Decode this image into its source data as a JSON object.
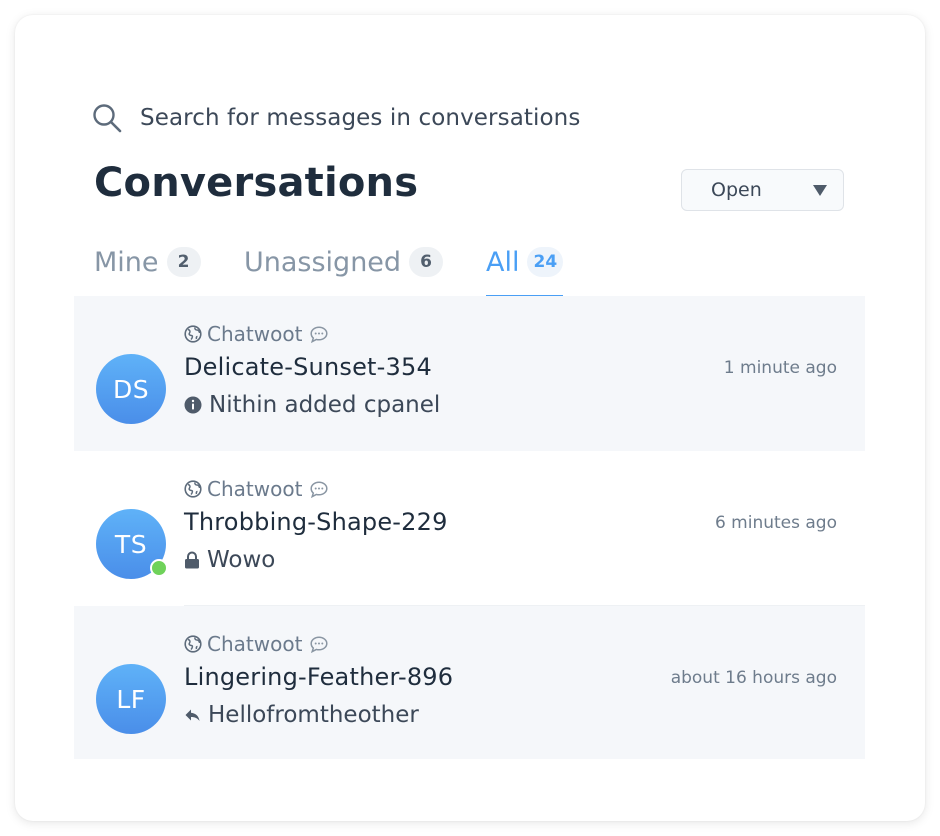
{
  "search": {
    "placeholder": "Search for messages in conversations"
  },
  "header": {
    "title": "Conversations",
    "status_filter": "Open"
  },
  "tabs": [
    {
      "label": "Mine",
      "count": "2"
    },
    {
      "label": "Unassigned",
      "count": "6"
    },
    {
      "label": "All",
      "count": "24",
      "active": true
    }
  ],
  "conversations": [
    {
      "initials": "DS",
      "inbox": "Chatwoot",
      "name": "Delicate-Sunset-354",
      "time": "1 minute ago",
      "message": "Nithin added cpanel",
      "message_icon": "info-icon",
      "online": false
    },
    {
      "initials": "TS",
      "inbox": "Chatwoot",
      "name": "Throbbing-Shape-229",
      "time": "6 minutes ago",
      "message": "Wowo",
      "message_icon": "lock-icon",
      "online": true
    },
    {
      "initials": "LF",
      "inbox": "Chatwoot",
      "name": "Lingering-Feather-896",
      "time": "about 16 hours ago",
      "message": "Hellofromtheother",
      "message_icon": "reply-icon",
      "online": false
    }
  ],
  "colors": {
    "accent": "#4a9ff5",
    "avatar": "#4a8ee9",
    "online": "#6fd25a",
    "row_highlight": "#f5f7fa"
  }
}
